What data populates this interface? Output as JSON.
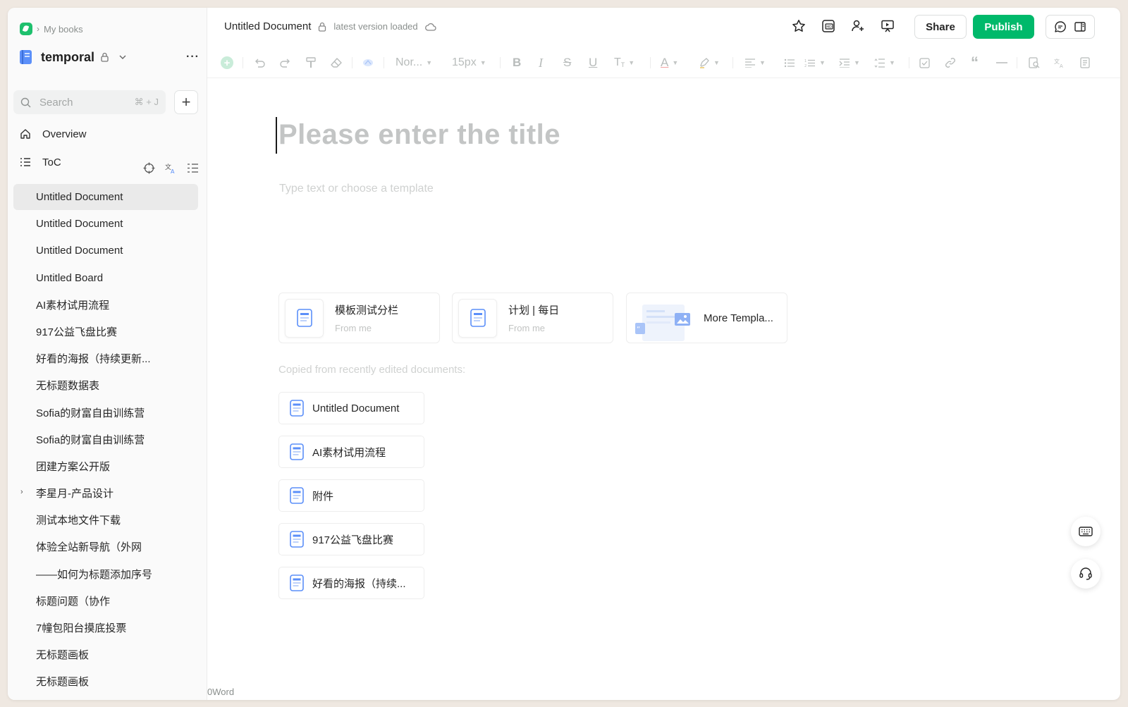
{
  "breadcrumb": {
    "root": "My books"
  },
  "book": {
    "title": "temporal"
  },
  "search": {
    "placeholder": "Search",
    "shortcut": "⌘ + J"
  },
  "nav": {
    "overview": "Overview",
    "toc": "ToC"
  },
  "sidebar": {
    "documents": [
      {
        "label": "Untitled Document",
        "active": true,
        "expandable": false
      },
      {
        "label": "Untitled Document",
        "active": false,
        "expandable": false
      },
      {
        "label": "Untitled Document",
        "active": false,
        "expandable": false
      },
      {
        "label": "Untitled Board",
        "active": false,
        "expandable": false
      },
      {
        "label": "AI素材试用流程",
        "active": false,
        "expandable": false
      },
      {
        "label": "917公益飞盘比赛",
        "active": false,
        "expandable": false
      },
      {
        "label": "好看的海报（持续更新...",
        "active": false,
        "expandable": false
      },
      {
        "label": "无标题数据表",
        "active": false,
        "expandable": false
      },
      {
        "label": "Sofia的财富自由训练营",
        "active": false,
        "expandable": false
      },
      {
        "label": "Sofia的财富自由训练营",
        "active": false,
        "expandable": false
      },
      {
        "label": "团建方案公开版",
        "active": false,
        "expandable": false
      },
      {
        "label": "李星月-产品设计",
        "active": false,
        "expandable": true
      },
      {
        "label": "测试本地文件下载",
        "active": false,
        "expandable": false
      },
      {
        "label": "体验全站新导航（外网",
        "active": false,
        "expandable": false
      },
      {
        "label": "——如何为标题添加序号",
        "active": false,
        "expandable": false
      },
      {
        "label": "标题问题（协作",
        "active": false,
        "expandable": false
      },
      {
        "label": "7幢包阳台摸底投票",
        "active": false,
        "expandable": false
      },
      {
        "label": "无标题画板",
        "active": false,
        "expandable": false
      },
      {
        "label": "无标题画板",
        "active": false,
        "expandable": false
      }
    ]
  },
  "header": {
    "doc_title": "Untitled Document",
    "status": "latest version loaded",
    "share_label": "Share",
    "publish_label": "Publish"
  },
  "toolbar": {
    "style_value": "Nor...",
    "font_size": "15px"
  },
  "editor": {
    "title_placeholder": "Please enter the title",
    "body_placeholder": "Type text or choose a template"
  },
  "templates": [
    {
      "name": "模板测试分栏",
      "from": "From me"
    },
    {
      "name": "计划 | 每日",
      "from": "From me"
    }
  ],
  "more_templates": "More Templa...",
  "copied_label": "Copied from recently edited documents:",
  "recent_docs": [
    "Untitled Document",
    "AI素材试用流程",
    "附件",
    "917公益飞盘比赛",
    "好看的海报（持续..."
  ],
  "footer": {
    "word_count": "0Word"
  },
  "colors": {
    "brand": "#00b96b",
    "doc_icon": "#5b8ff9",
    "sidebar_bg": "#fafafa"
  }
}
